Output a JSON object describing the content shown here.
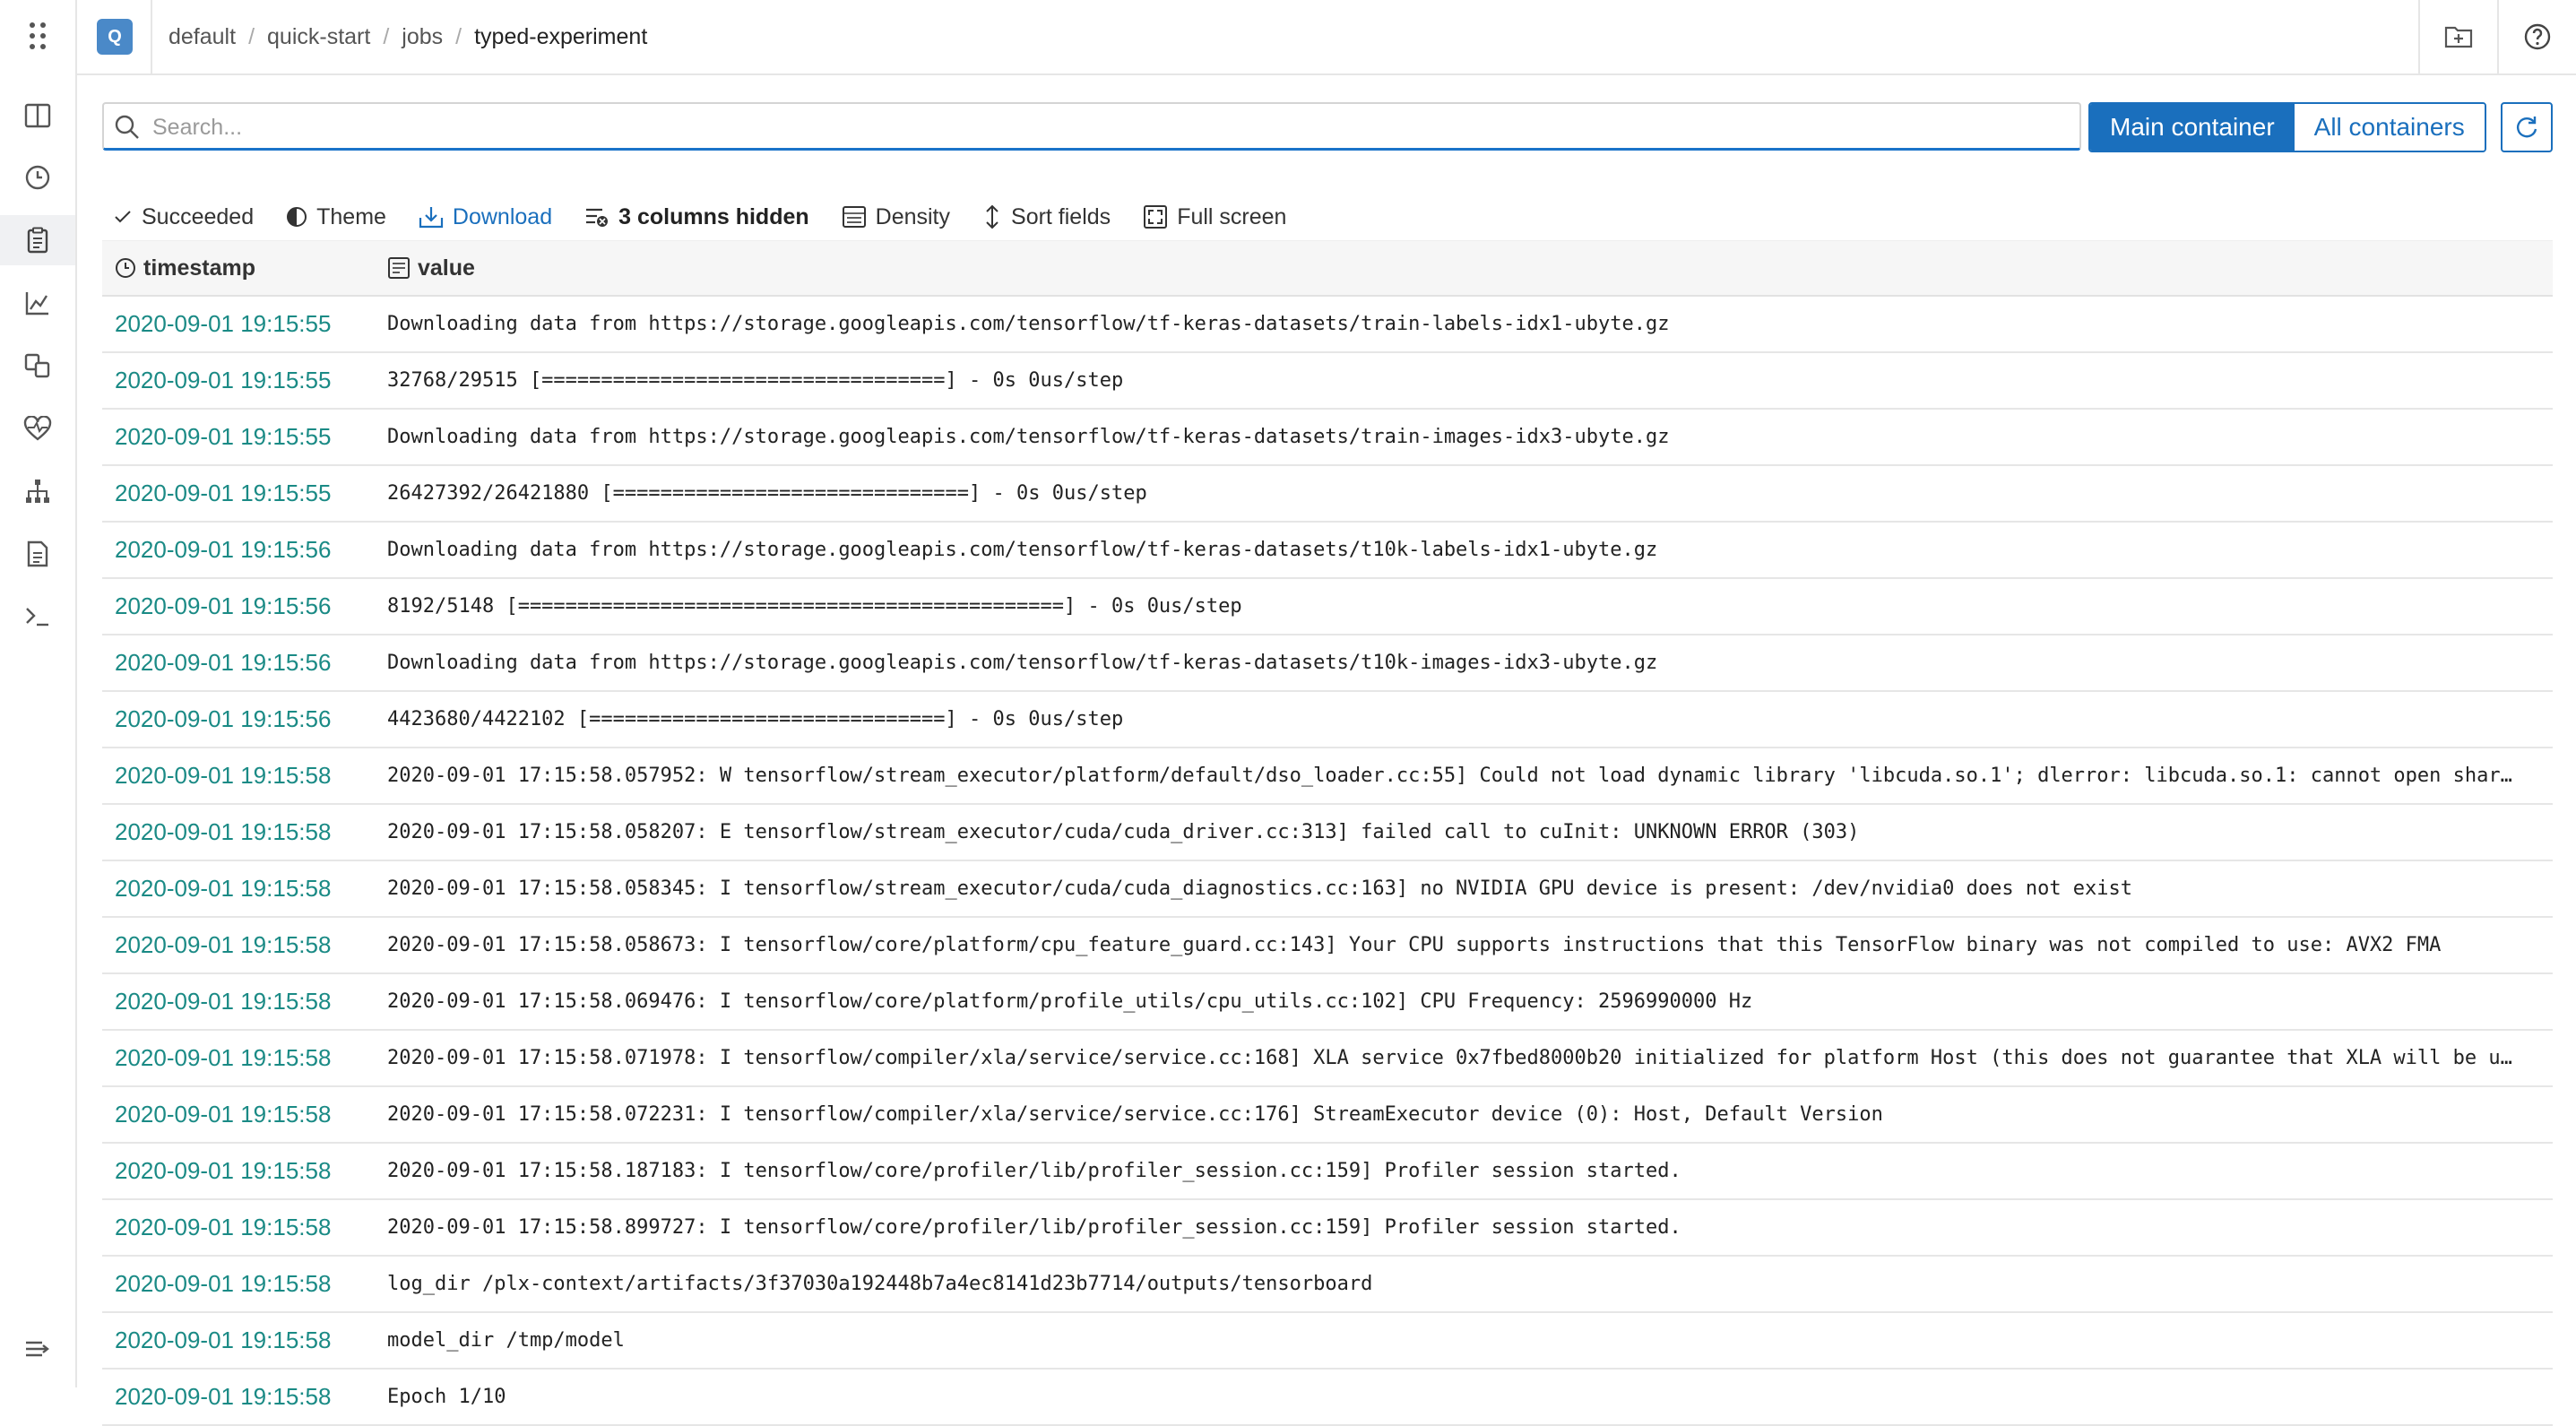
{
  "project": {
    "avatar_letter": "Q"
  },
  "breadcrumb": [
    "default",
    "quick-start",
    "jobs",
    "typed-experiment"
  ],
  "search": {
    "placeholder": "Search...",
    "value": ""
  },
  "containers": {
    "main_label": "Main container",
    "all_label": "All containers"
  },
  "toolbar": {
    "status": "Succeeded",
    "theme": "Theme",
    "download": "Download",
    "hidden_columns": "3 columns hidden",
    "density": "Density",
    "sort": "Sort fields",
    "fullscreen": "Full screen"
  },
  "table": {
    "columns": [
      "timestamp",
      "value"
    ],
    "rows": [
      {
        "ts": "2020-09-01 19:15:55",
        "value": "Downloading data from https://storage.googleapis.com/tensorflow/tf-keras-datasets/train-labels-idx1-ubyte.gz"
      },
      {
        "ts": "2020-09-01 19:15:55",
        "value": "32768/29515 [==================================] - 0s 0us/step"
      },
      {
        "ts": "2020-09-01 19:15:55",
        "value": "Downloading data from https://storage.googleapis.com/tensorflow/tf-keras-datasets/train-images-idx3-ubyte.gz"
      },
      {
        "ts": "2020-09-01 19:15:55",
        "value": "26427392/26421880 [==============================] - 0s 0us/step"
      },
      {
        "ts": "2020-09-01 19:15:56",
        "value": "Downloading data from https://storage.googleapis.com/tensorflow/tf-keras-datasets/t10k-labels-idx1-ubyte.gz"
      },
      {
        "ts": "2020-09-01 19:15:56",
        "value": "8192/5148 [==============================================] - 0s 0us/step"
      },
      {
        "ts": "2020-09-01 19:15:56",
        "value": "Downloading data from https://storage.googleapis.com/tensorflow/tf-keras-datasets/t10k-images-idx3-ubyte.gz"
      },
      {
        "ts": "2020-09-01 19:15:56",
        "value": "4423680/4422102 [==============================] - 0s 0us/step"
      },
      {
        "ts": "2020-09-01 19:15:58",
        "value": "2020-09-01 17:15:58.057952: W tensorflow/stream_executor/platform/default/dso_loader.cc:55] Could not load dynamic library 'libcuda.so.1'; dlerror: libcuda.so.1: cannot open shar…"
      },
      {
        "ts": "2020-09-01 19:15:58",
        "value": "2020-09-01 17:15:58.058207: E tensorflow/stream_executor/cuda/cuda_driver.cc:313] failed call to cuInit: UNKNOWN ERROR (303)"
      },
      {
        "ts": "2020-09-01 19:15:58",
        "value": "2020-09-01 17:15:58.058345: I tensorflow/stream_executor/cuda/cuda_diagnostics.cc:163] no NVIDIA GPU device is present: /dev/nvidia0 does not exist"
      },
      {
        "ts": "2020-09-01 19:15:58",
        "value": "2020-09-01 17:15:58.058673: I tensorflow/core/platform/cpu_feature_guard.cc:143] Your CPU supports instructions that this TensorFlow binary was not compiled to use: AVX2 FMA"
      },
      {
        "ts": "2020-09-01 19:15:58",
        "value": "2020-09-01 17:15:58.069476: I tensorflow/core/platform/profile_utils/cpu_utils.cc:102] CPU Frequency: 2596990000 Hz"
      },
      {
        "ts": "2020-09-01 19:15:58",
        "value": "2020-09-01 17:15:58.071978: I tensorflow/compiler/xla/service/service.cc:168] XLA service 0x7fbed8000b20 initialized for platform Host (this does not guarantee that XLA will be u…"
      },
      {
        "ts": "2020-09-01 19:15:58",
        "value": "2020-09-01 17:15:58.072231: I tensorflow/compiler/xla/service/service.cc:176] StreamExecutor device (0): Host, Default Version"
      },
      {
        "ts": "2020-09-01 19:15:58",
        "value": "2020-09-01 17:15:58.187183: I tensorflow/core/profiler/lib/profiler_session.cc:159] Profiler session started."
      },
      {
        "ts": "2020-09-01 19:15:58",
        "value": "2020-09-01 17:15:58.899727: I tensorflow/core/profiler/lib/profiler_session.cc:159] Profiler session started."
      },
      {
        "ts": "2020-09-01 19:15:58",
        "value": "log_dir /plx-context/artifacts/3f37030a192448b7a4ec8141d23b7714/outputs/tensorboard"
      },
      {
        "ts": "2020-09-01 19:15:58",
        "value": "model_dir /tmp/model"
      },
      {
        "ts": "2020-09-01 19:15:58",
        "value": "Epoch 1/10"
      }
    ]
  },
  "colors": {
    "accent": "#1a6fbd",
    "timestamp": "#1a8a85",
    "avatar": "#4a89c8"
  },
  "icons": {
    "sidebar": [
      "apps-grid-icon",
      "panel-icon",
      "clock-icon",
      "clipboard-icon",
      "chart-icon",
      "artifacts-icon",
      "heartbeat-icon",
      "hierarchy-icon",
      "document-icon",
      "terminal-icon",
      "collapse-icon"
    ]
  }
}
